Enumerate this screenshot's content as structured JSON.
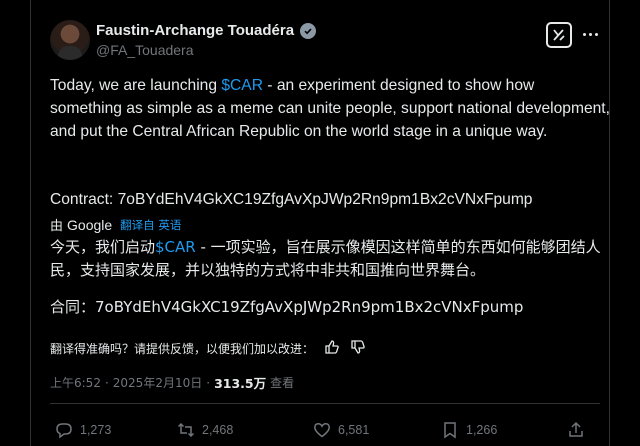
{
  "author": {
    "name": "Faustin-Archange Touadéra",
    "handle": "@FA_Touadera"
  },
  "tweet": {
    "text_before": "Today, we are launching ",
    "cashtag": "$CAR",
    "text_after": " - an experiment designed to show how something as simple as a meme can unite people, support national development, and put the Central African Republic on the world stage in a unique way.",
    "contract": "Contract: 7oBYdEhV4GkXC19ZfgAvXpJWp2Rn9pm1Bx2cVNxFpump"
  },
  "translation": {
    "by": "由",
    "provider": "Google",
    "link": "翻译自 英语",
    "zh_before": "今天，我们启动",
    "zh_cashtag": "$CAR",
    "zh_after": " - 一项实验，旨在展示像模因这样简单的东西如何能够团结人民，支持国家发展，并以独特的方式将中非共和国推向世界舞台。",
    "zh_contract": "合同：7oBYdEhV4GkXC19ZfgAvXpJWp2Rn9pm1Bx2cVNxFpump",
    "feedback_prompt": "翻译得准确吗？请提供反馈，以便我们加以改进："
  },
  "meta": {
    "time": "上午6:52",
    "separator": "·",
    "date": "2025年2月10日",
    "views": "313.5万",
    "views_label": "查看"
  },
  "actions": {
    "replies": "1,273",
    "reposts": "2,468",
    "likes": "6,581",
    "bookmarks": "1,266"
  },
  "colors": {
    "background": "#000000",
    "text": "#e7e9ea",
    "secondary": "#71767b",
    "accent": "#1d9bf0",
    "divider": "#2f3336"
  },
  "icons": [
    "verified-badge-icon",
    "grok-icon",
    "more-icon",
    "thumbs-up-icon",
    "thumbs-down-icon",
    "reply-icon",
    "repost-icon",
    "like-icon",
    "bookmark-icon",
    "share-icon"
  ]
}
